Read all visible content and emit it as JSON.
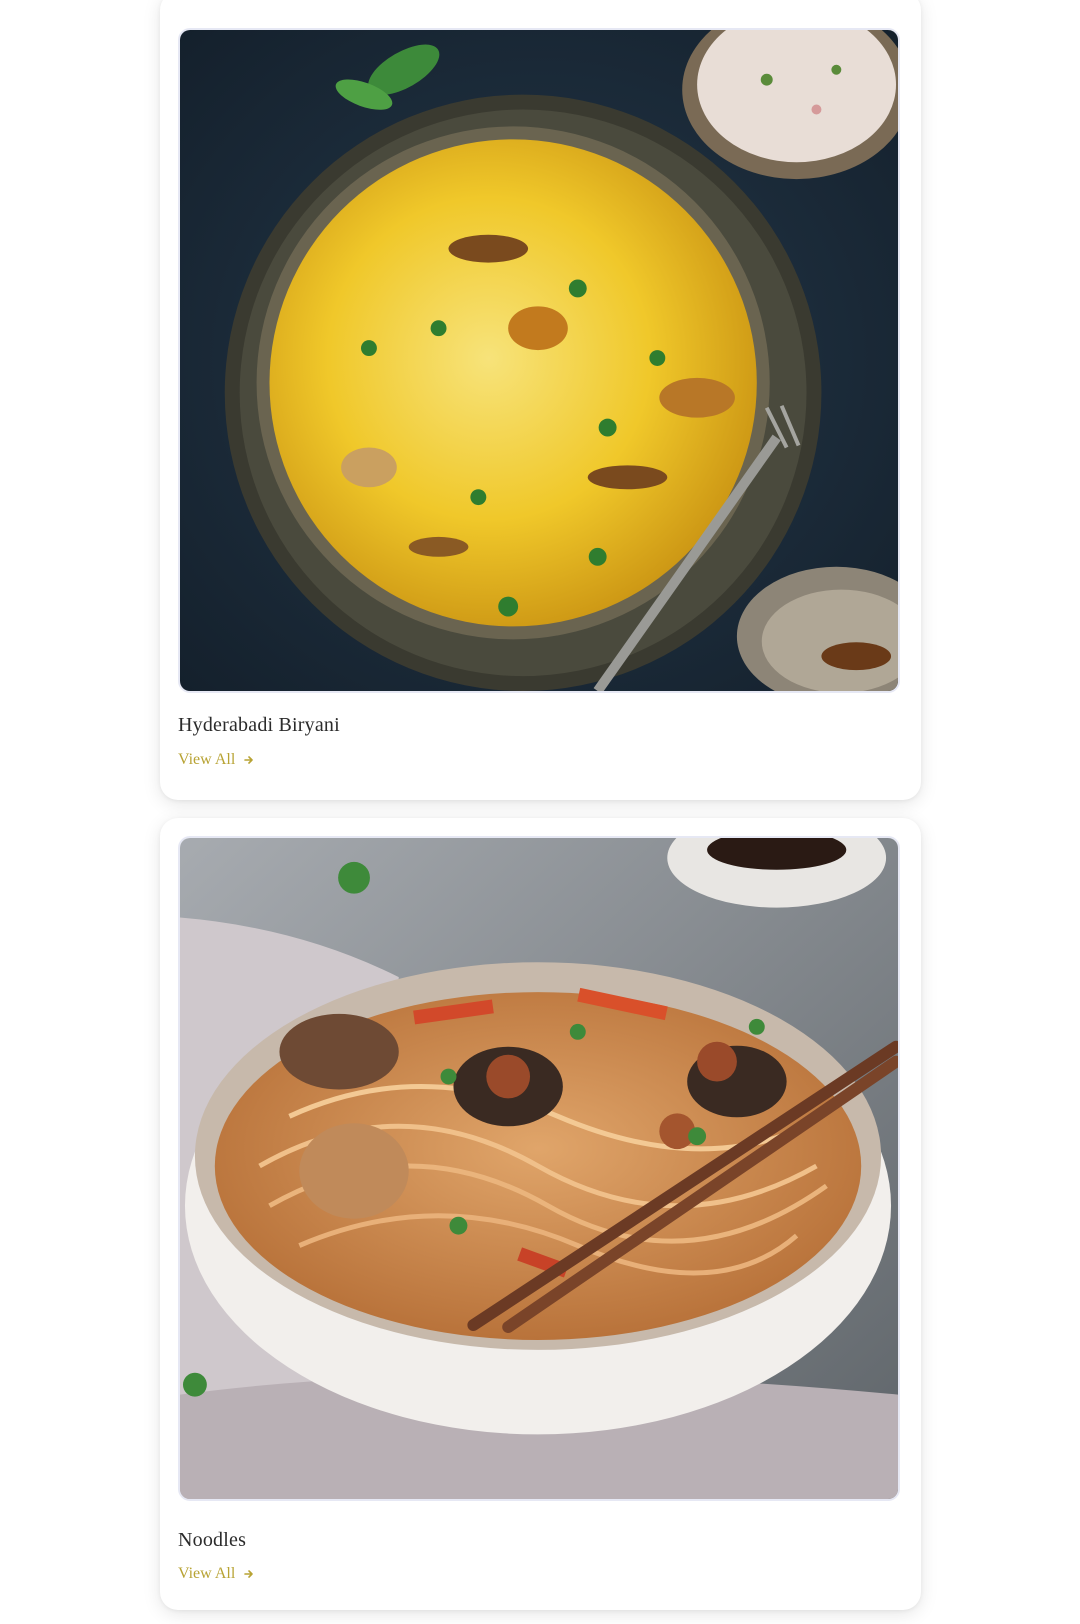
{
  "cards": [
    {
      "title": "Hyderabadi Biryani",
      "link_label": "View All",
      "image_subject": "biryani-photo",
      "link_icon": "arrow-right-icon"
    },
    {
      "title": "Noodles",
      "link_label": "View All",
      "image_subject": "noodles-photo",
      "link_icon": "arrow-right-icon"
    }
  ],
  "colors": {
    "link": "#b8a334",
    "title": "#2b2b2b",
    "card_background": "#ffffff",
    "image_border": "#e6e8f4"
  }
}
